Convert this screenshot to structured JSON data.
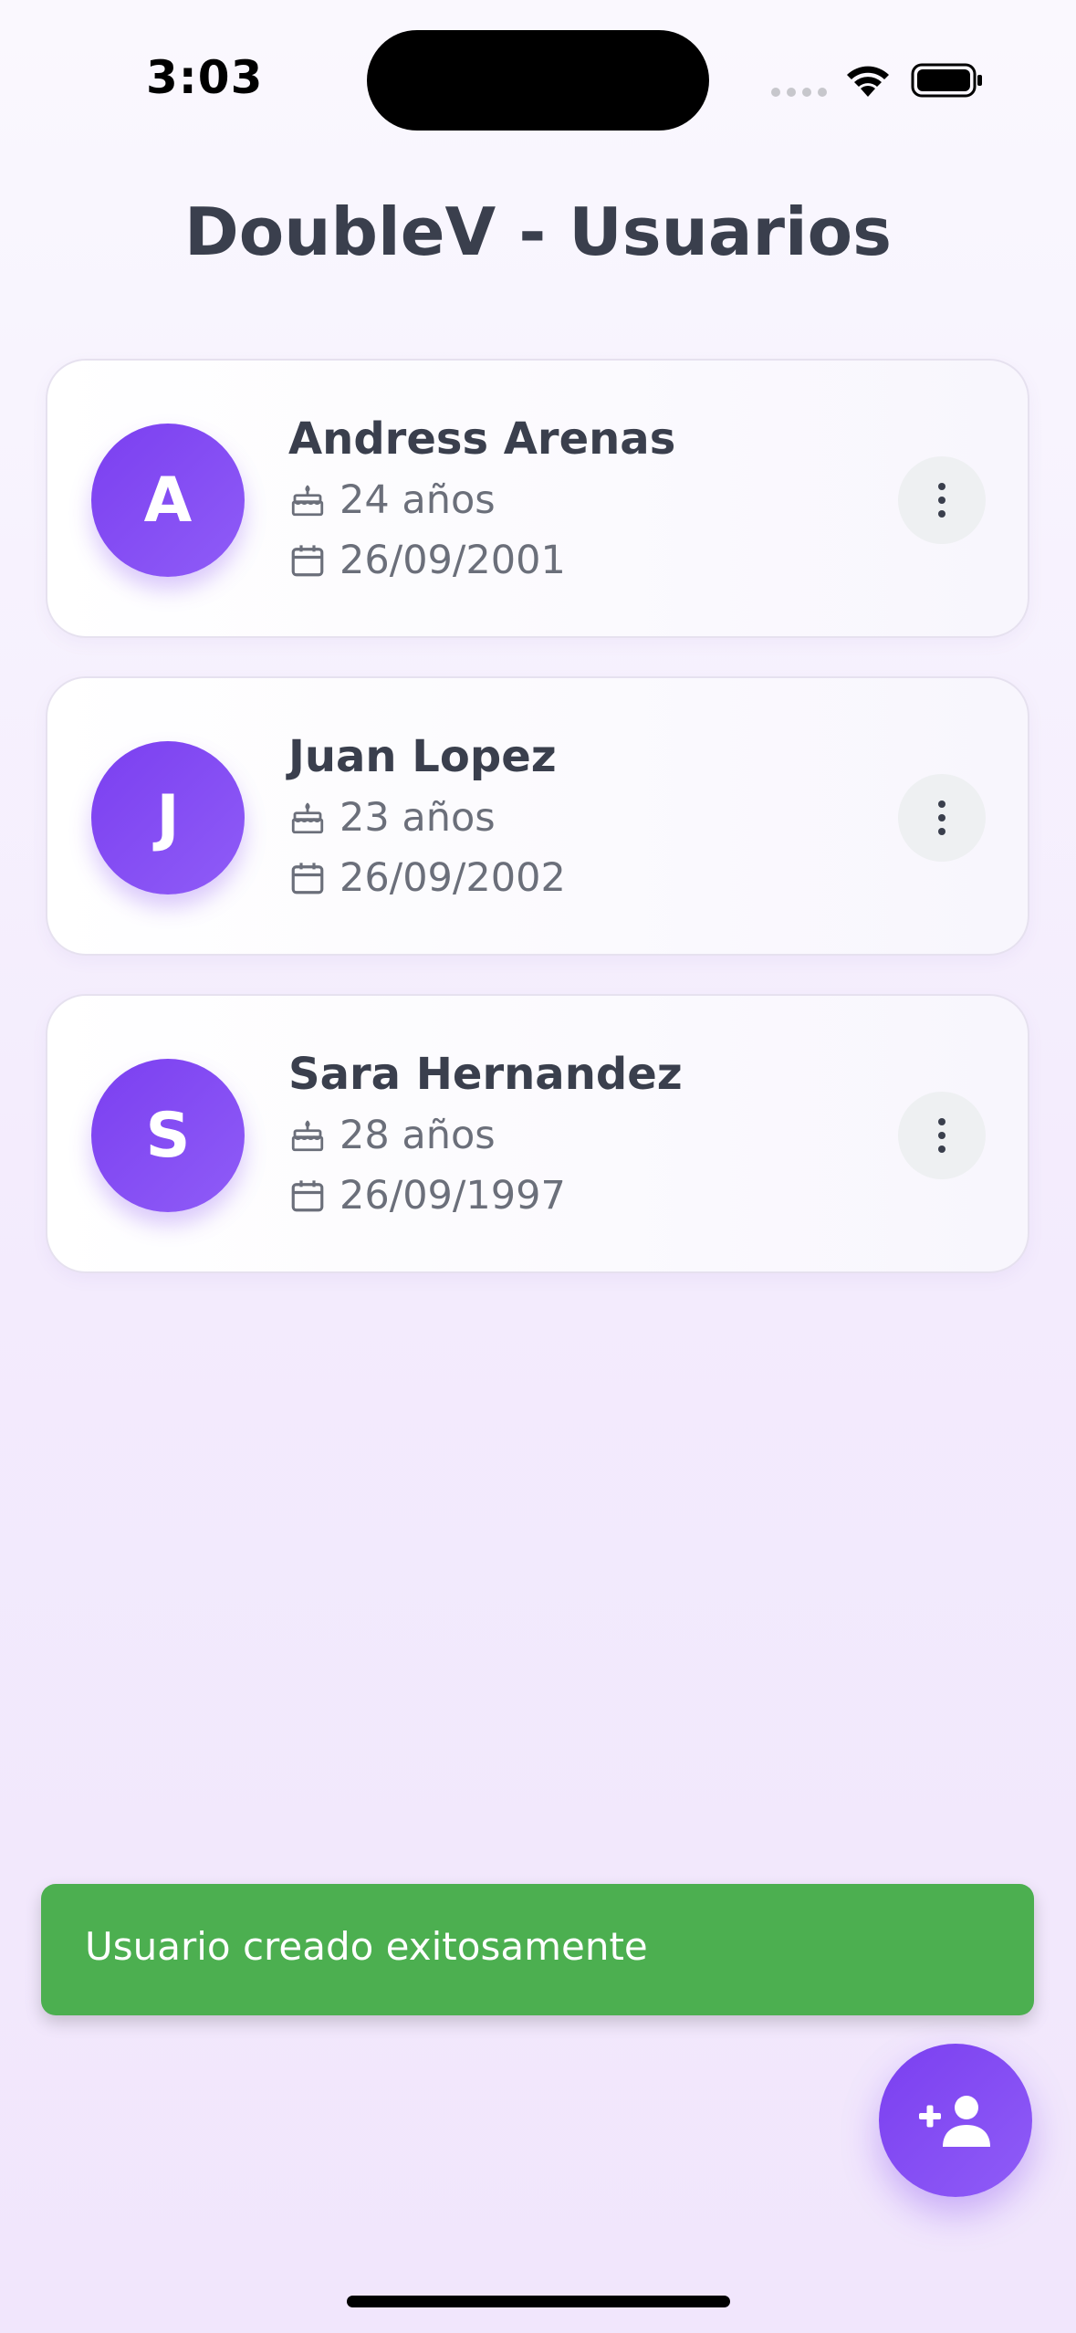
{
  "status_bar": {
    "time": "3:03"
  },
  "header": {
    "title": "DoubleV - Usuarios"
  },
  "users": [
    {
      "initial": "A",
      "name": "Andress Arenas",
      "age": "24 años",
      "birthdate": "26/09/2001"
    },
    {
      "initial": "J",
      "name": "Juan Lopez",
      "age": "23 años",
      "birthdate": "26/09/2002"
    },
    {
      "initial": "S",
      "name": "Sara Hernandez",
      "age": "28 años",
      "birthdate": "26/09/1997"
    }
  ],
  "icons": {
    "age": "cake-icon",
    "date": "calendar-icon",
    "menu": "more-vertical-icon",
    "fab": "person-add-icon"
  },
  "snackbar": {
    "message": "Usuario creado exitosamente"
  },
  "colors": {
    "accent": "#7c3fef",
    "success": "#4caf50",
    "text": "#3a3f4d",
    "muted": "#6b6f7a"
  }
}
